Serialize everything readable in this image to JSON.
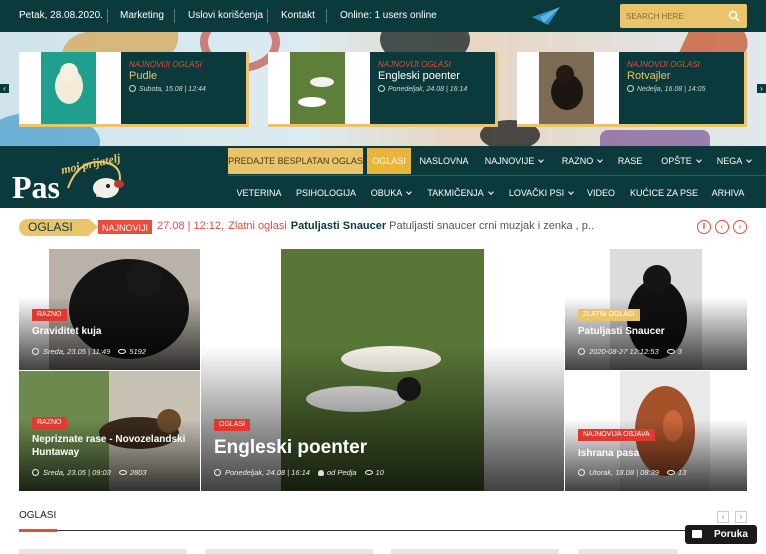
{
  "topbar": {
    "date": "Petak, 28.08.2020.",
    "links": [
      "Marketing",
      "Uslovi korišćenja",
      "Kontakt"
    ],
    "online": "Online: 1 users online",
    "search_placeholder": "SEARCH HERE"
  },
  "featured": [
    {
      "kicker": "NAJNOVIJI OGLASI",
      "title": "Pudle",
      "meta": "Subota, 15.08 | 12:44"
    },
    {
      "kicker": "NAJNOVIJI OGLASI",
      "title": "Engleski poenter",
      "meta": "Ponedeljak, 24.08 | 16:14"
    },
    {
      "kicker": "NAJNOVIJI OGLASI",
      "title": "Rotvajler",
      "meta": "Nedelja, 16.08 | 14:05"
    }
  ],
  "brand": {
    "main": "Pas",
    "sub": "moj prijatelj"
  },
  "nav": {
    "row1": [
      {
        "label": "PREDAJTE BESPLATAN OGLAS"
      },
      {
        "label": "OGLASI"
      },
      {
        "label": "NASLOVNA"
      },
      {
        "label": "NAJNOVIJE"
      },
      {
        "label": "RAZNO"
      },
      {
        "label": "RASE"
      },
      {
        "label": "OPŠTE"
      },
      {
        "label": "NEGA"
      }
    ],
    "row2": [
      {
        "label": "VETERINA"
      },
      {
        "label": "PSIHOLOGIJA"
      },
      {
        "label": "OBUKA"
      },
      {
        "label": "TAKMIČENJA"
      },
      {
        "label": "LOVAČKI PSI"
      },
      {
        "label": "VIDEO"
      },
      {
        "label": "KUĆICE ZA PSE"
      },
      {
        "label": "ARHIVA"
      }
    ]
  },
  "ticker": {
    "label": "OGLASI",
    "badge": "NAJNOVIJI",
    "date": "27.08 | 12:12,",
    "category": "Zlatni oglasi",
    "title": "Patuljasti Snaucer",
    "excerpt": "Patuljasti snaucer crni muzjak i zenka , p.."
  },
  "cards": [
    {
      "badge": "RAZNO",
      "title": "Graviditet kuja",
      "date": "Sreda, 23.05 | 11:49",
      "views": "5192"
    },
    {
      "badge": "RAZNO",
      "title": "Nepriznate rase - Novozelandski",
      "title2": "Huntaway",
      "date": "Sreda, 23.05 | 09:03",
      "views": "2803"
    },
    {
      "badge": "OGLASI",
      "title": "Engleski poenter",
      "date": "Ponedeljak, 24.08 | 16:14",
      "author": "od Pedja",
      "views": "10"
    },
    {
      "badge": "ZLATNI OGLASI",
      "title": "Patuljasti Snaucer",
      "date": "2020-08-27 12:12:53",
      "views": "3"
    },
    {
      "badge": "NAJNOVIJA OBJAVA",
      "title": "Ishrana pasa",
      "date": "Utorak, 18.08 | 08:39",
      "views": "13"
    }
  ],
  "section": {
    "title": "OGLASI"
  },
  "chat": {
    "label": "Poruka"
  },
  "colors": {
    "primary": "#0b3a3c",
    "accent": "#e9c46a",
    "red": "#e74c3c"
  }
}
